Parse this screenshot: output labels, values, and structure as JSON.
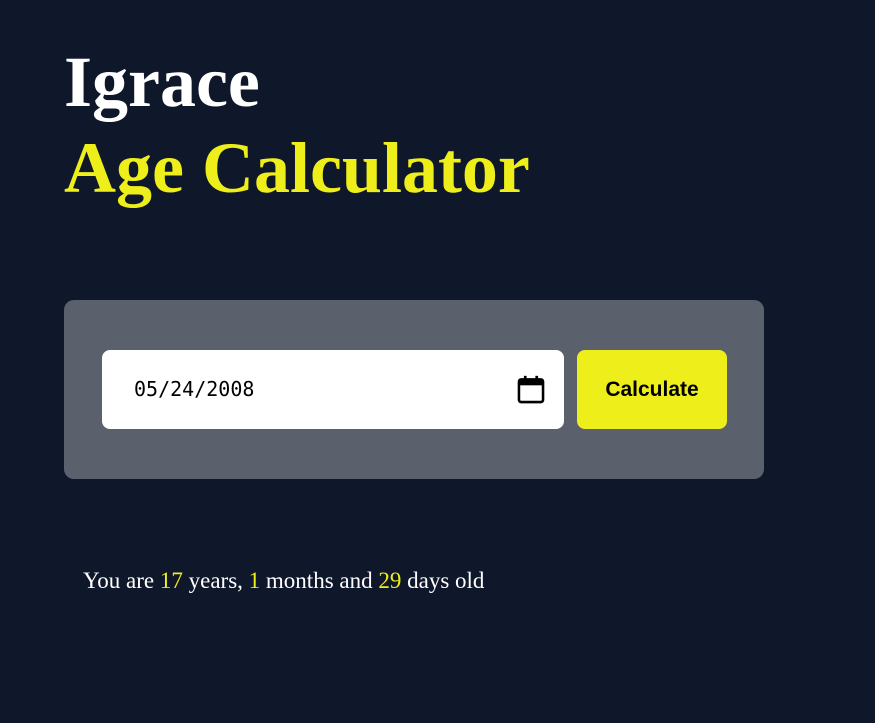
{
  "header": {
    "brand": "Igrace",
    "title": "Age Calculator"
  },
  "form": {
    "date_value": "05/24/2008",
    "calendar_icon": "calendar-icon",
    "button_label": "Calculate"
  },
  "result": {
    "prefix": "You are",
    "years": "17",
    "years_label": "years,",
    "months": "1",
    "months_label": "months and",
    "days": "29",
    "days_label": "days old"
  },
  "colors": {
    "background": "#0f172a",
    "accent": "#eeee1a",
    "panel": "#5b606d",
    "text": "#ffffff"
  }
}
